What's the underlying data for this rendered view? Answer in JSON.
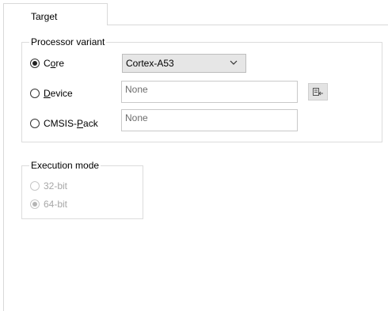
{
  "tabs": [
    {
      "label": "Target"
    }
  ],
  "processor_variant": {
    "title": "Processor variant",
    "core": {
      "prefix": "C",
      "underlined": "o",
      "suffix": "re",
      "selected": true
    },
    "core_select": {
      "value": "Cortex-A53"
    },
    "device": {
      "prefix": "",
      "underlined": "D",
      "suffix": "evice",
      "selected": false
    },
    "device_field": {
      "value": "None"
    },
    "cmsis": {
      "prefix": "CMSIS-",
      "underlined": "P",
      "suffix": "ack",
      "selected": false
    },
    "cmsis_field": {
      "value": "None"
    },
    "select_device_icon": "select-device-icon"
  },
  "execution_mode": {
    "title": "Execution mode",
    "options": [
      {
        "label": "32-bit",
        "selected": false,
        "disabled": true
      },
      {
        "label": "64-bit",
        "selected": true,
        "disabled": true
      }
    ]
  }
}
